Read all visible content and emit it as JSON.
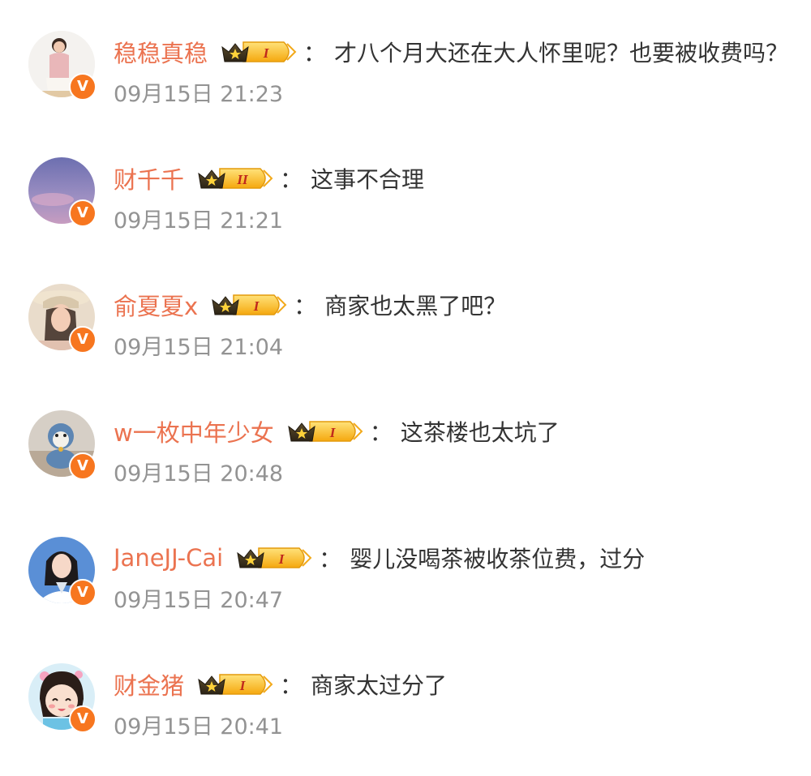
{
  "colors": {
    "username": "#eb7350",
    "text": "#333333",
    "time": "#939393",
    "badge": "#f7761f"
  },
  "separator": "：",
  "comments": [
    {
      "username": "稳稳真稳",
      "level": "I",
      "text": "才八个月大还在大人怀里呢？也要被收费吗？",
      "time": "09月15日 21:23",
      "avatar": "baby-photo"
    },
    {
      "username": "财千千",
      "level": "II",
      "text": "这事不合理",
      "time": "09月15日 21:21",
      "avatar": "sky-photo"
    },
    {
      "username": "俞夏夏x",
      "level": "I",
      "text": "商家也太黑了吧？",
      "time": "09月15日 21:04",
      "avatar": "woman-hat-photo"
    },
    {
      "username": "w一枚中年少女",
      "level": "I",
      "text": "这茶楼也太坑了",
      "time": "09月15日 20:48",
      "avatar": "toy-photo"
    },
    {
      "username": "JaneJJ-Cai",
      "level": "I",
      "text": "婴儿没喝茶被收茶位费，过分",
      "time": "09月15日 20:47",
      "avatar": "woman-portrait-photo"
    },
    {
      "username": "财金猪",
      "level": "I",
      "text": "商家太过分了",
      "time": "09月15日 20:41",
      "avatar": "cartoon-girl"
    }
  ]
}
